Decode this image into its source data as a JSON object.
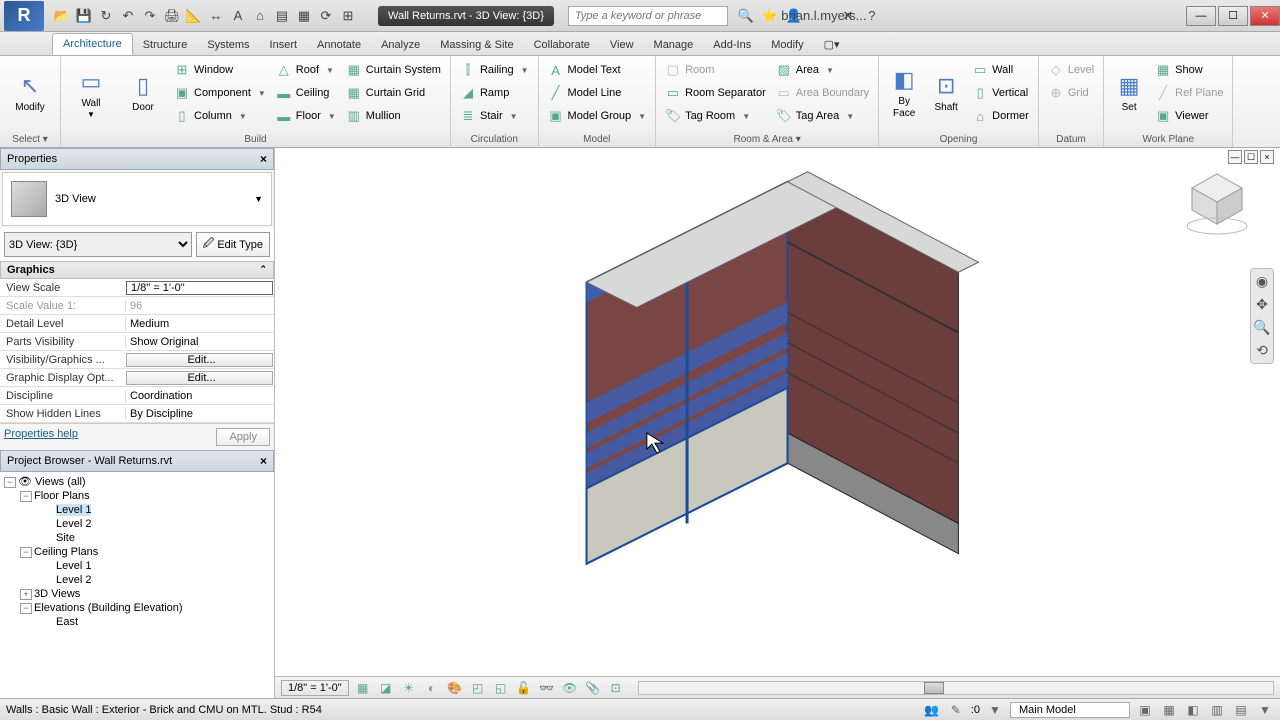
{
  "titlebar": {
    "doc_title": "Wall Returns.rvt - 3D View: {3D}",
    "search_placeholder": "Type a keyword or phrase",
    "user": "brian.l.myers..."
  },
  "ribbon": {
    "tabs": [
      "Architecture",
      "Structure",
      "Systems",
      "Insert",
      "Annotate",
      "Analyze",
      "Massing & Site",
      "Collaborate",
      "View",
      "Manage",
      "Add-Ins",
      "Modify"
    ],
    "active_tab": "Architecture",
    "select": {
      "modify": "Modify",
      "panel": "Select ▾"
    },
    "build": {
      "wall": "Wall",
      "door": "Door",
      "window": "Window",
      "component": "Component",
      "column": "Column",
      "roof": "Roof",
      "ceiling": "Ceiling",
      "floor": "Floor",
      "curtain_system": "Curtain System",
      "curtain_grid": "Curtain Grid",
      "mullion": "Mullion",
      "panel": "Build"
    },
    "circulation": {
      "railing": "Railing",
      "ramp": "Ramp",
      "stair": "Stair",
      "panel": "Circulation"
    },
    "model": {
      "text": "Model Text",
      "line": "Model Line",
      "group": "Model Group",
      "panel": "Model"
    },
    "room_area": {
      "room": "Room",
      "room_sep": "Room Separator",
      "tag_room": "Tag Room",
      "area": "Area",
      "area_boundary": "Area Boundary",
      "tag_area": "Tag Area",
      "panel": "Room & Area ▾"
    },
    "opening": {
      "by_face": "By Face",
      "shaft": "Shaft",
      "wall_op": "Wall",
      "vertical": "Vertical",
      "dormer": "Dormer",
      "panel": "Opening"
    },
    "datum": {
      "level": "Level",
      "grid": "Grid",
      "panel": "Datum"
    },
    "workplane": {
      "set": "Set",
      "show": "Show",
      "ref_plane": "Ref Plane",
      "viewer": "Viewer",
      "panel": "Work Plane"
    }
  },
  "properties": {
    "title": "Properties",
    "type_name": "3D View",
    "instance_sel": "3D View: {3D}",
    "edit_type": "Edit Type",
    "section": "Graphics",
    "rows": {
      "view_scale": {
        "k": "View Scale",
        "v": "1/8\" = 1'-0\""
      },
      "scale_value": {
        "k": "Scale Value    1:",
        "v": "96"
      },
      "detail_level": {
        "k": "Detail Level",
        "v": "Medium"
      },
      "parts_vis": {
        "k": "Parts Visibility",
        "v": "Show Original"
      },
      "vis_graphics": {
        "k": "Visibility/Graphics ...",
        "v": "Edit..."
      },
      "graphic_disp": {
        "k": "Graphic Display Opt...",
        "v": "Edit..."
      },
      "discipline": {
        "k": "Discipline",
        "v": "Coordination"
      },
      "hidden_lines": {
        "k": "Show Hidden Lines",
        "v": "By Discipline"
      }
    },
    "help": "Properties help",
    "apply": "Apply"
  },
  "browser": {
    "title": "Project Browser - Wall Returns.rvt",
    "views_all": "Views (all)",
    "floor_plans": "Floor Plans",
    "level1": "Level 1",
    "level2": "Level 2",
    "site": "Site",
    "ceiling_plans": "Ceiling Plans",
    "cp_level1": "Level 1",
    "cp_level2": "Level 2",
    "views3d": "3D Views",
    "elevations": "Elevations (Building Elevation)",
    "east": "East"
  },
  "viewbar": {
    "scale": "1/8\" = 1'-0\""
  },
  "status": {
    "msg": "Walls : Basic Wall : Exterior - Brick and CMU on MTL. Stud : R54",
    "sel_count": ":0",
    "workset": "Main Model"
  }
}
